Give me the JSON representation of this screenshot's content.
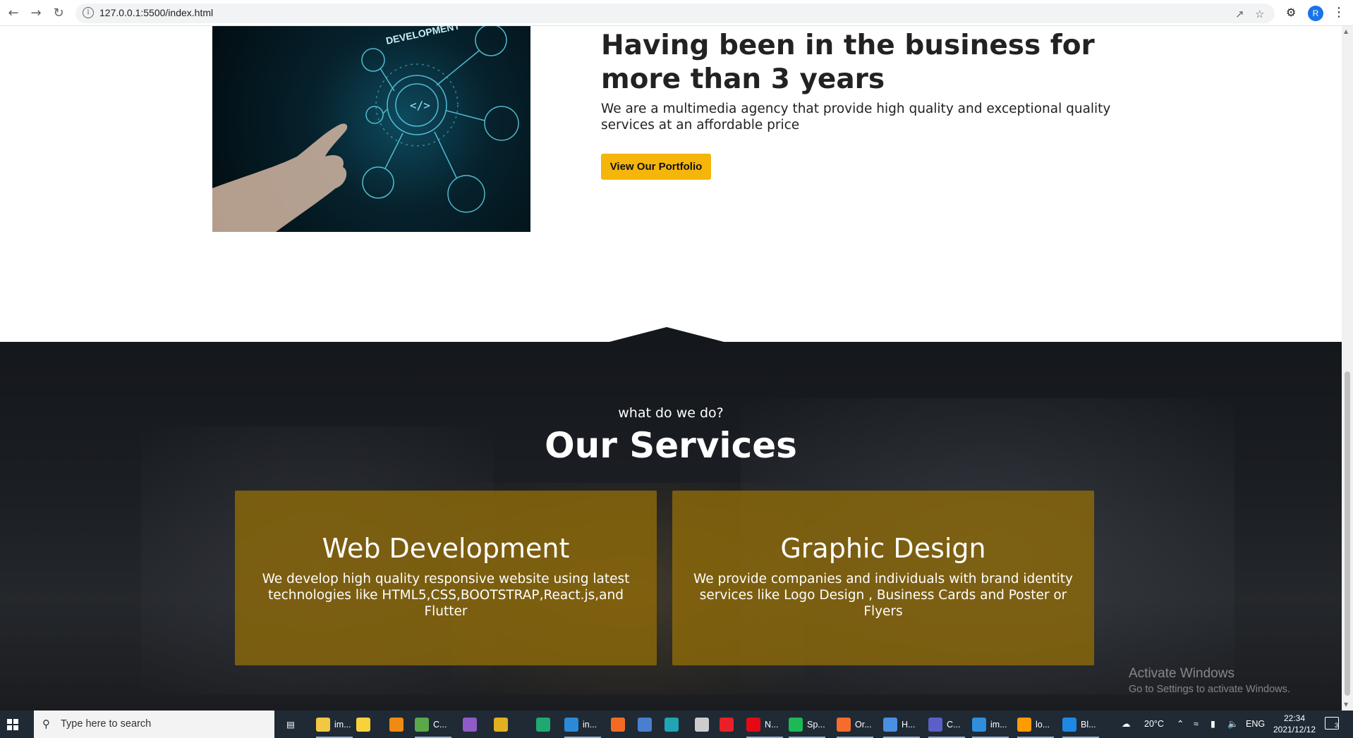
{
  "browser": {
    "url": "127.0.0.1:5500/index.html",
    "profile_initial": "R"
  },
  "about": {
    "title": "Having been in the business for more than 3 years",
    "text": "We are a multimedia agency that provide high quality and exceptional quality services at an affordable price",
    "button": "View Our Portfolio",
    "image_caption": "DEVELOPMENT"
  },
  "services": {
    "kicker": "what do we do?",
    "title": "Our Services",
    "cards": [
      {
        "title": "Web Development",
        "text": "We develop high quality responsive website using latest technologies like HTML5,CSS,BOOTSTRAP,React.js,and Flutter"
      },
      {
        "title": "Graphic Design",
        "text": "We provide companies and individuals with brand identity services like Logo Design , Business Cards and Poster or Flyers"
      }
    ]
  },
  "watermark": {
    "line1": "Activate Windows",
    "line2": "Go to Settings to activate Windows."
  },
  "taskbar": {
    "search_placeholder": "Type here to search",
    "apps": [
      {
        "label": "im...",
        "icon": "file-explorer-icon",
        "color": "#f2c744"
      },
      {
        "label": "",
        "icon": "player-icon",
        "color": "#f7d23a"
      },
      {
        "label": "",
        "icon": "vlc-icon",
        "color": "#f08a12"
      },
      {
        "label": "C...",
        "icon": "notepad-icon",
        "color": "#5aa84a"
      },
      {
        "label": "",
        "icon": "visual-studio-icon",
        "color": "#8e5bc8"
      },
      {
        "label": "",
        "icon": "chrome-icon",
        "color": "#e0b020"
      },
      {
        "label": "",
        "icon": "gitkraken-icon",
        "color": "#1fa870"
      },
      {
        "label": "in...",
        "icon": "vscode-icon",
        "color": "#2a8ad8"
      },
      {
        "label": "",
        "icon": "xampp-icon",
        "color": "#f36b22"
      },
      {
        "label": "",
        "icon": "music-icon",
        "color": "#4a7fd0"
      },
      {
        "label": "",
        "icon": "three-icon",
        "color": "#1fa5b5"
      },
      {
        "label": "",
        "icon": "unity-icon",
        "color": "#cccccc"
      },
      {
        "label": "",
        "icon": "opera-icon",
        "color": "#e8202a"
      },
      {
        "label": "N...",
        "icon": "netflix-icon",
        "color": "#e50914"
      },
      {
        "label": "Sp...",
        "icon": "spotify-icon",
        "color": "#1db954"
      },
      {
        "label": "Or...",
        "icon": "origin-icon",
        "color": "#f56c2d"
      },
      {
        "label": "H...",
        "icon": "chrome-profile-icon",
        "color": "#4a90e2"
      },
      {
        "label": "C...",
        "icon": "teams-icon",
        "color": "#5b5fc7"
      },
      {
        "label": "im...",
        "icon": "photos-icon",
        "color": "#2f8fdc"
      },
      {
        "label": "lo...",
        "icon": "illustrator-icon",
        "color": "#ff9a00"
      },
      {
        "label": "Bl...",
        "icon": "bluetooth-icon",
        "color": "#1e88e5"
      }
    ],
    "weather": "20°C",
    "language": "ENG",
    "time": "22:34",
    "date": "2021/12/12",
    "notifications": "3"
  }
}
